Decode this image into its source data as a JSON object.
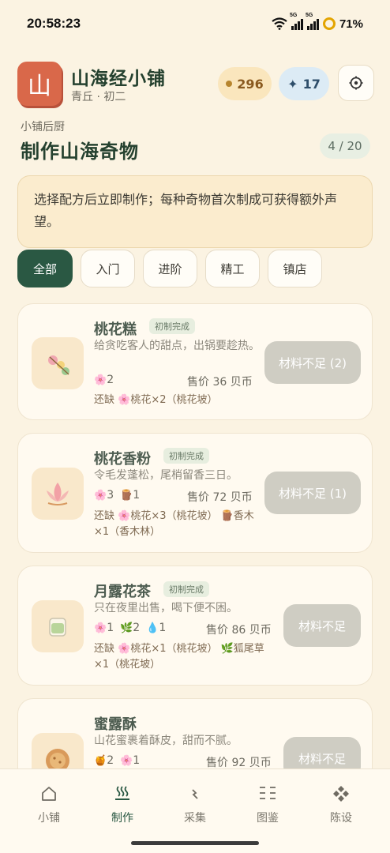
{
  "status": {
    "time": "20:58:23",
    "net1": "5G",
    "net2": "5G",
    "battery": "71%"
  },
  "header": {
    "logo_char": "山",
    "shop_name": "山海经小铺",
    "shop_sub": "青丘 · 初二",
    "coins": "296",
    "stars": "17",
    "settings_icon": "gear-icon"
  },
  "section": {
    "kicker": "小铺后厨",
    "title": "制作山海奇物",
    "progress": "4 / 20"
  },
  "notice": "选择配方后立即制作；每种奇物首次制成可获得额外声望。",
  "tabs": [
    {
      "label": "全部",
      "active": true
    },
    {
      "label": "入门"
    },
    {
      "label": "进阶"
    },
    {
      "label": "精工"
    },
    {
      "label": "镇店"
    }
  ],
  "recipes": [
    {
      "name": "桃花糕",
      "badge": "初制完成",
      "desc": "给贪吃客人的甜点，出锅要趁热。",
      "ingredients": [
        {
          "icon": "🌸",
          "qty": "2"
        }
      ],
      "price": "售价 36 贝币",
      "missing": "还缺 🌸桃花×2（桃花坡）",
      "button": "材料不足 (2)"
    },
    {
      "name": "桃花香粉",
      "badge": "初制完成",
      "desc": "令毛发蓬松，尾梢留香三日。",
      "ingredients": [
        {
          "icon": "🌸",
          "qty": "3"
        },
        {
          "icon": "🪵",
          "qty": "1"
        }
      ],
      "price": "售价 72 贝币",
      "missing": "还缺 🌸桃花×3（桃花坡）  🪵香木×1（香木林）",
      "button": "材料不足 (1)"
    },
    {
      "name": "月露花茶",
      "badge": "初制完成",
      "desc": "只在夜里出售，喝下便不困。",
      "ingredients": [
        {
          "icon": "🌸",
          "qty": "1"
        },
        {
          "icon": "🌿",
          "qty": "2"
        },
        {
          "icon": "💧",
          "qty": "1"
        }
      ],
      "price": "售价 86 贝币",
      "missing": "还缺 🌸桃花×1（桃花坡）  🌿狐尾草×1（桃花坡）",
      "button": "材料不足"
    },
    {
      "name": "蜜露酥",
      "badge": "",
      "desc": "山花蜜裹着酥皮，甜而不腻。",
      "ingredients": [
        {
          "icon": "🍯",
          "qty": "2"
        },
        {
          "icon": "🌸",
          "qty": "1"
        }
      ],
      "price": "售价 92 贝币",
      "missing": "",
      "button": "材料不足"
    }
  ],
  "nav": [
    {
      "label": "小铺",
      "icon": "home-icon"
    },
    {
      "label": "制作",
      "icon": "steam-icon",
      "active": true
    },
    {
      "label": "采集",
      "icon": "spark-icon"
    },
    {
      "label": "图鉴",
      "icon": "catalog-icon"
    },
    {
      "label": "陈设",
      "icon": "diamond-grid-icon"
    }
  ]
}
